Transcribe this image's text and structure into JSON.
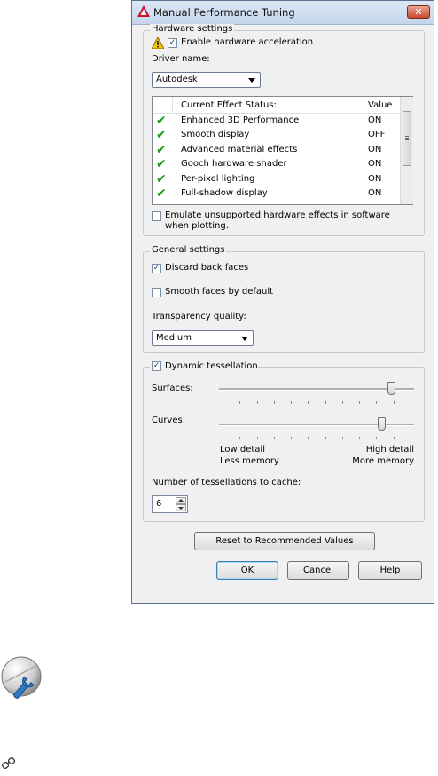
{
  "window": {
    "title": "Manual Performance Tuning",
    "close_glyph": "✕"
  },
  "hardware": {
    "group_label": "Hardware settings",
    "enable_accel_label": "Enable hardware acceleration",
    "enable_accel_checked": true,
    "driver_label": "Driver name:",
    "driver_value": "Autodesk",
    "list_header_status": "Current Effect Status:",
    "list_header_value": "Value",
    "effects": [
      {
        "name": "Enhanced 3D Performance",
        "value": "ON"
      },
      {
        "name": "Smooth display",
        "value": "OFF"
      },
      {
        "name": "Advanced material effects",
        "value": "ON"
      },
      {
        "name": "Gooch hardware shader",
        "value": "ON"
      },
      {
        "name": "Per-pixel lighting",
        "value": "ON"
      },
      {
        "name": "Full-shadow display",
        "value": "ON"
      }
    ],
    "emulate_line1": "Emulate unsupported hardware effects in software",
    "emulate_line2": "when plotting.",
    "emulate_checked": false
  },
  "general": {
    "group_label": "General settings",
    "discard_label": "Discard back faces",
    "discard_checked": true,
    "smooth_label": "Smooth faces by default",
    "smooth_checked": false,
    "transparency_label": "Transparency quality:",
    "transparency_value": "Medium"
  },
  "tessellation": {
    "label": "Dynamic tessellation",
    "checked": true,
    "surfaces_label": "Surfaces:",
    "surfaces_level": 0.9,
    "curves_label": "Curves:",
    "curves_level": 0.85,
    "low_detail": "Low detail",
    "less_memory": "Less memory",
    "high_detail": "High detail",
    "more_memory": "More memory",
    "cache_label": "Number of tessellations to cache:",
    "cache_value": "6"
  },
  "buttons": {
    "reset": "Reset to Recommended Values",
    "ok": "OK",
    "cancel": "Cancel",
    "help": "Help"
  },
  "colors": {
    "accent": "#3c7fb1",
    "check_green": "#1a9a1a",
    "warning_yellow": "#f2c400"
  }
}
